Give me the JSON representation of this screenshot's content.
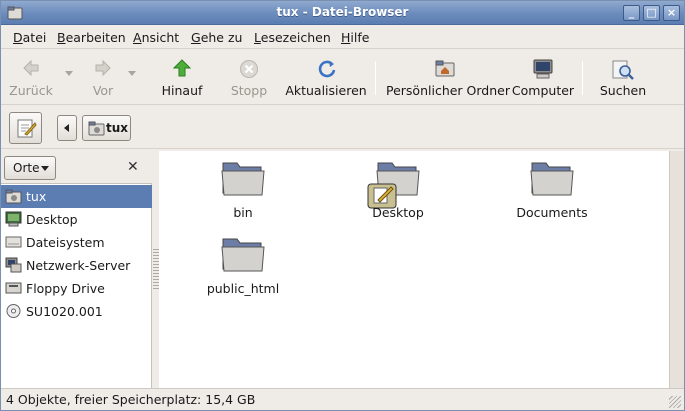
{
  "window": {
    "title": "tux - Datei-Browser"
  },
  "menu": [
    "Datei",
    "Bearbeiten",
    "Ansicht",
    "Gehe zu",
    "Lesezeichen",
    "Hilfe"
  ],
  "toolbar": {
    "back": "Zurück",
    "forward": "Vor",
    "up": "Hinauf",
    "stop": "Stopp",
    "reload": "Aktualisieren",
    "home": "Persönlicher Ordner",
    "computer": "Computer",
    "search": "Suchen"
  },
  "location": {
    "path_button": "tux"
  },
  "sidebar": {
    "header": "Orte",
    "items": [
      {
        "label": "tux",
        "icon": "home-folder-icon",
        "selected": true
      },
      {
        "label": "Desktop",
        "icon": "desktop-icon"
      },
      {
        "label": "Dateisystem",
        "icon": "harddisk-icon"
      },
      {
        "label": "Netzwerk-Server",
        "icon": "network-server-icon"
      },
      {
        "label": "Floppy Drive",
        "icon": "floppy-drive-icon"
      },
      {
        "label": "SU1020.001",
        "icon": "cd-icon"
      }
    ]
  },
  "files": [
    {
      "name": "bin",
      "icon": "folder-icon"
    },
    {
      "name": "Desktop",
      "icon": "desktop-folder-icon"
    },
    {
      "name": "Documents",
      "icon": "folder-icon"
    },
    {
      "name": "public_html",
      "icon": "folder-icon"
    }
  ],
  "status": "4 Objekte, freier Speicherplatz: 15,4 GB",
  "colors": {
    "titlebar": "#6c8cbd",
    "selection": "#5b7db1",
    "background": "#efebe7"
  }
}
